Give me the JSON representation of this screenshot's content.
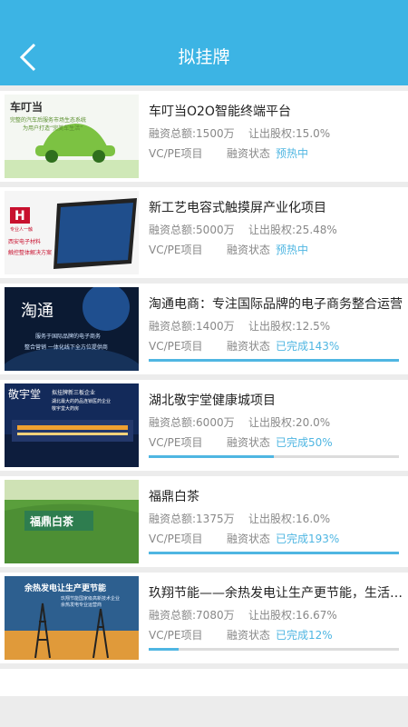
{
  "header": {
    "title": "拟挂牌"
  },
  "labels": {
    "total_prefix": "融资总额:",
    "equity_prefix": "让出股权:",
    "status_label": "融资状态"
  },
  "colors": {
    "accent": "#3cb4e4",
    "status": "#4fb6e2"
  },
  "projects": [
    {
      "name": "车叮当O2O智能终端平台",
      "total": "1500万",
      "equity": "15.0%",
      "type": "VC/PE项目",
      "status": "预热中",
      "progress": null,
      "thumb": {
        "kind": "car",
        "brand": "车叮当",
        "lines": [
          "完整的汽车后服务市场生态系统",
          "为用户打造“完美车生活”"
        ]
      }
    },
    {
      "name": "新工艺电容式触摸屏产业化项目",
      "total": "5000万",
      "equity": "25.48%",
      "type": "VC/PE项目",
      "status": "预热中",
      "progress": null,
      "thumb": {
        "kind": "tablet",
        "brand": "H",
        "lines": [
          "专业人一触",
          "西安电子材料",
          "触控整体解决方案"
        ]
      }
    },
    {
      "name": "淘通电商：专注国际品牌的电子商务整合运营",
      "total": "1400万",
      "equity": "12.5%",
      "type": "VC/PE项目",
      "status": "已完成143%",
      "progress": 1.43,
      "thumb": {
        "kind": "space",
        "brand": "淘通",
        "lines": [
          "服务于国际品牌的电子商务",
          "整合营销 一体化线下全方位提供商"
        ]
      }
    },
    {
      "name": "湖北敬宇堂健康城项目",
      "total": "6000万",
      "equity": "20.0%",
      "type": "VC/PE项目",
      "status": "已完成50%",
      "progress": 0.5,
      "thumb": {
        "kind": "night",
        "brand": "敬宇堂",
        "lines": [
          "拟挂牌新三板企业",
          "湖北最大的药品连锁医药企业",
          "敬宇堂大药房"
        ]
      }
    },
    {
      "name": "福鼎白茶",
      "total": "1375万",
      "equity": "16.0%",
      "type": "VC/PE项目",
      "status": "已完成193%",
      "progress": 1.93,
      "thumb": {
        "kind": "tea",
        "brand": "福鼎白茶",
        "lines": []
      }
    },
    {
      "name": "玖翔节能——余热发电让生产更节能，生活更美好",
      "total": "7080万",
      "equity": "16.67%",
      "type": "VC/PE项目",
      "status": "已完成12%",
      "progress": 0.12,
      "thumb": {
        "kind": "power",
        "brand": "余热发电让生产更节能",
        "lines": [
          "玖翔节能国家级高新技术企业",
          "余热发电专业运营商"
        ]
      }
    }
  ]
}
